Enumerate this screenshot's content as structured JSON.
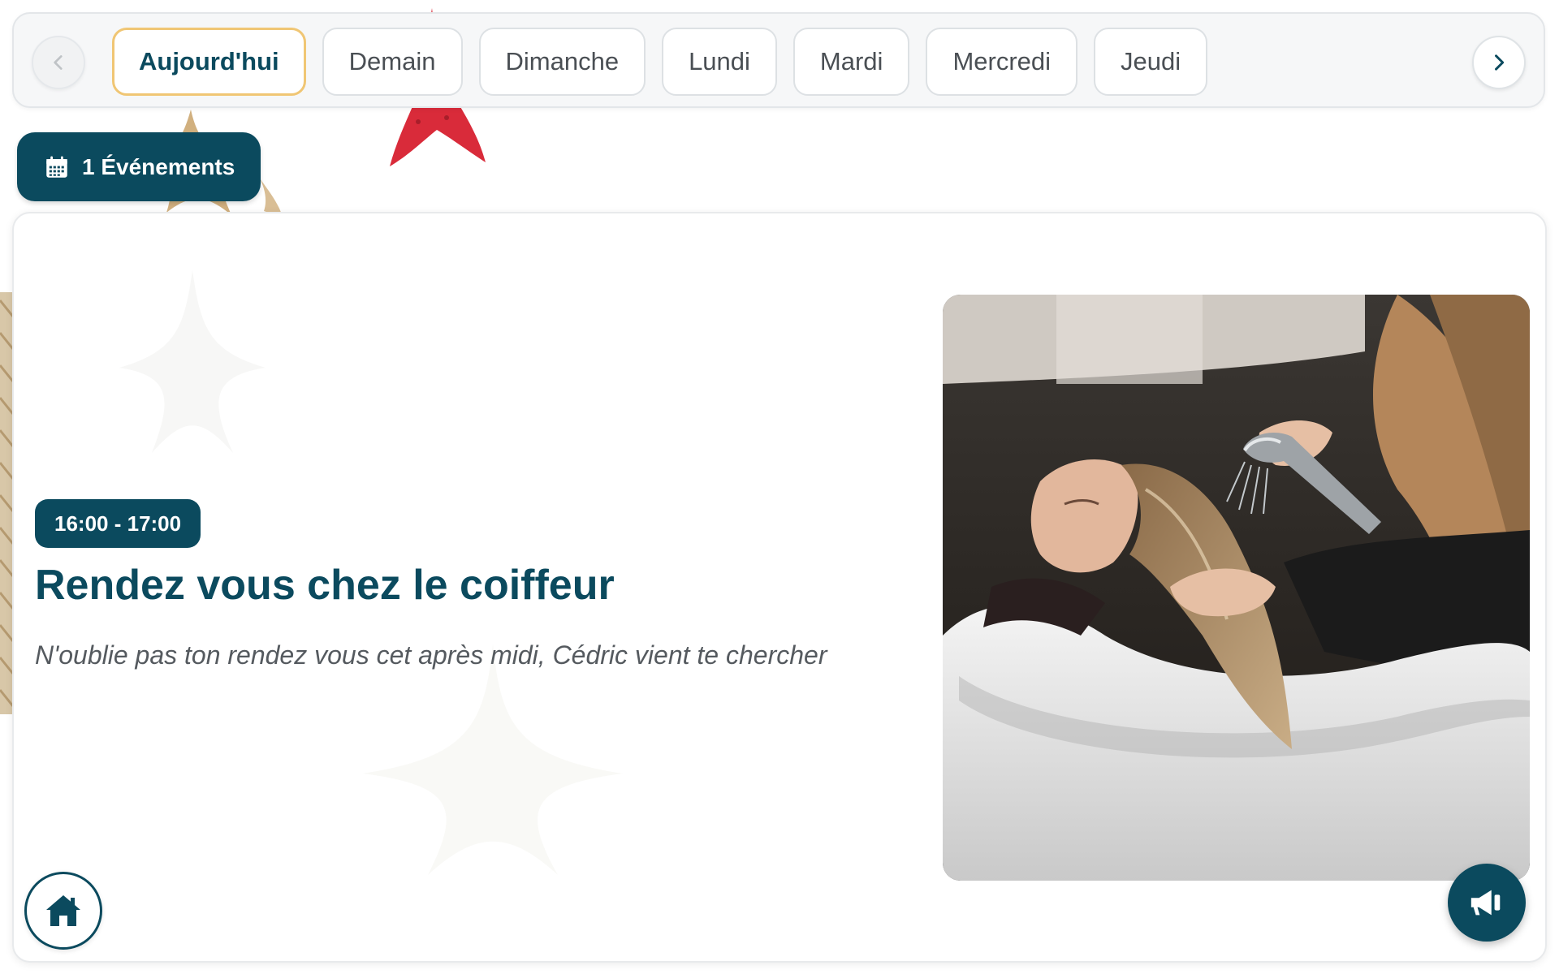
{
  "navigation": {
    "prev_icon": "chevron-left-icon",
    "next_icon": "chevron-right-icon",
    "days": [
      {
        "label": "Aujourd'hui",
        "active": true
      },
      {
        "label": "Demain",
        "active": false
      },
      {
        "label": "Dimanche",
        "active": false
      },
      {
        "label": "Lundi",
        "active": false
      },
      {
        "label": "Mardi",
        "active": false
      },
      {
        "label": "Mercredi",
        "active": false
      },
      {
        "label": "Jeudi",
        "active": false
      }
    ]
  },
  "events_summary": {
    "icon": "calendar-icon",
    "label": "1 Événements"
  },
  "event": {
    "time": "16:00 - 17:00",
    "title": "Rendez vous chez le coiffeur",
    "description": "N'oublie pas ton rendez vous cet après midi, Cédric vient te chercher",
    "image": "hair-washing-photo"
  },
  "actions": {
    "home_icon": "home-icon",
    "announce_icon": "megaphone-icon"
  },
  "colors": {
    "primary": "#0b4a5e",
    "active_tab_border": "#f0c674",
    "starfish_red": "#d92b3a",
    "starfish_tan": "#c9a268"
  }
}
